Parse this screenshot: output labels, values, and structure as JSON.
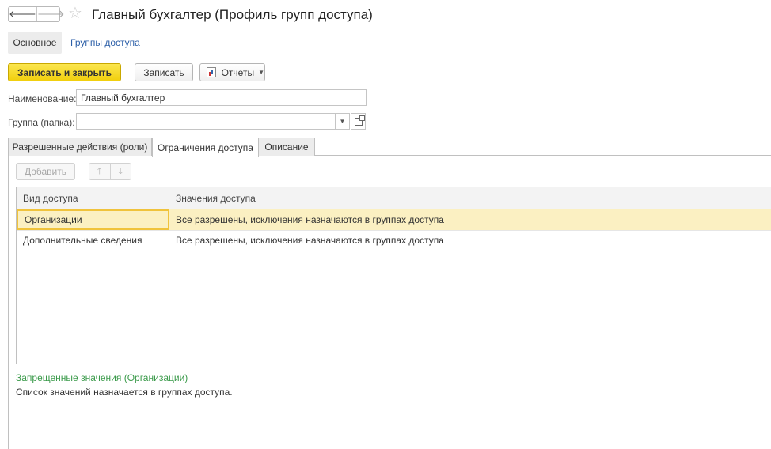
{
  "header": {
    "title": "Главный бухгалтер (Профиль групп доступа)",
    "back_icon": "arrow-left-icon",
    "forward_icon": "arrow-right-icon",
    "favorite_icon": "star-icon"
  },
  "sections": {
    "main": "Основное",
    "access_groups": "Группы доступа"
  },
  "toolbar": {
    "save_close": "Записать и закрыть",
    "save": "Записать",
    "reports": "Отчеты"
  },
  "form": {
    "name_label": "Наименование:",
    "name_value": "Главный бухгалтер",
    "group_label": "Группа (папка):",
    "group_value": ""
  },
  "tabs": [
    {
      "label": "Разрешенные действия (роли)"
    },
    {
      "label": "Ограничения доступа"
    },
    {
      "label": "Описание"
    }
  ],
  "inner_toolbar": {
    "add": "Добавить"
  },
  "table": {
    "columns": [
      "Вид доступа",
      "Значения доступа"
    ],
    "rows": [
      {
        "type": "Организации",
        "value": "Все разрешены, исключения назначаются в группах доступа"
      },
      {
        "type": "Дополнительные сведения",
        "value": "Все разрешены, исключения назначаются в группах доступа"
      }
    ]
  },
  "info": {
    "title": "Запрещенные значения (Организации)",
    "text": "Список значений назначается в группах доступа."
  },
  "colors": {
    "primary_button": "#f5d51a",
    "link": "#2c5fa8",
    "selected_row": "#fbf0c2",
    "info_title": "#3a9a4a"
  }
}
